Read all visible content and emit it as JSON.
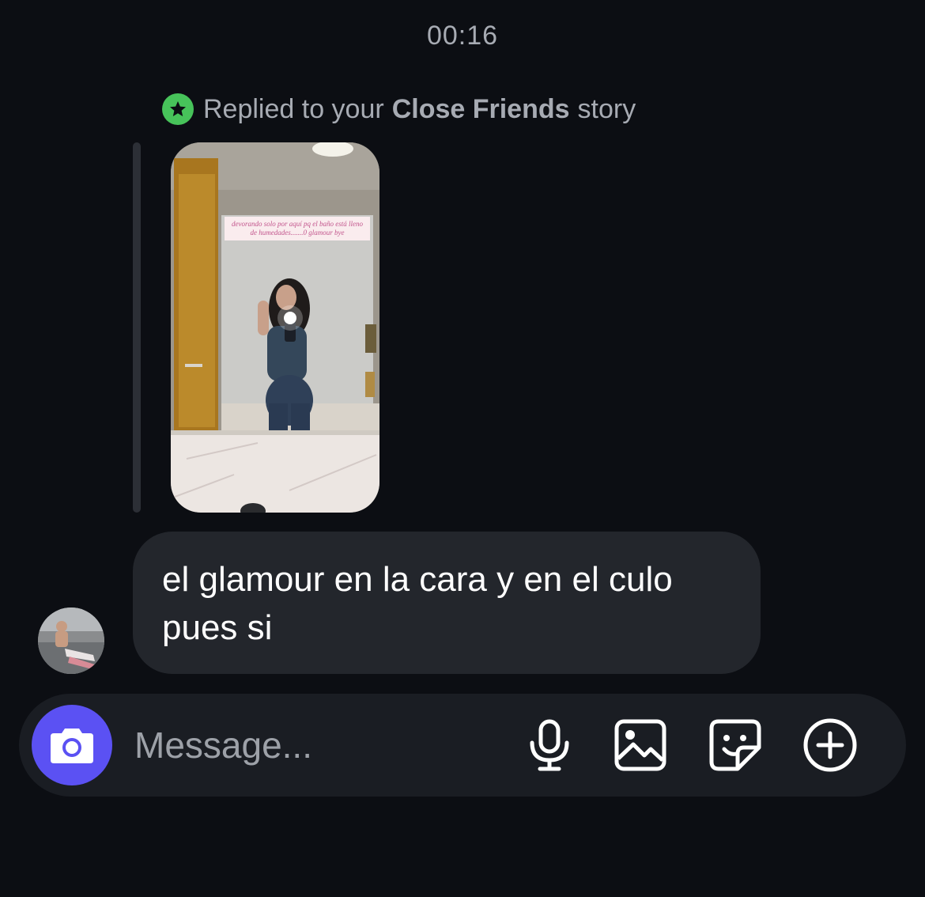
{
  "chat": {
    "timestamp": "00:16",
    "reply_prefix": "Replied to your",
    "reply_story_type": "Close Friends",
    "reply_suffix": "story",
    "story_caption": "devorando solo por aquí pq el baño está lleno de humedades.......0 glamour bye",
    "message_text": "el glamour en la cara y en el culo pues si"
  },
  "composer": {
    "placeholder": "Message..."
  },
  "colors": {
    "background": "#0c0e13",
    "bubble": "#23262c",
    "composer": "#1a1d23",
    "camera_button": "#5b51f3",
    "close_friends_badge": "#47c35a",
    "secondary_text": "#a7abb3"
  },
  "icons": {
    "close_friends": "star-badge-icon",
    "camera": "camera-icon",
    "microphone": "microphone-icon",
    "gallery": "gallery-icon",
    "sticker": "sticker-icon",
    "add": "plus-circle-icon"
  }
}
